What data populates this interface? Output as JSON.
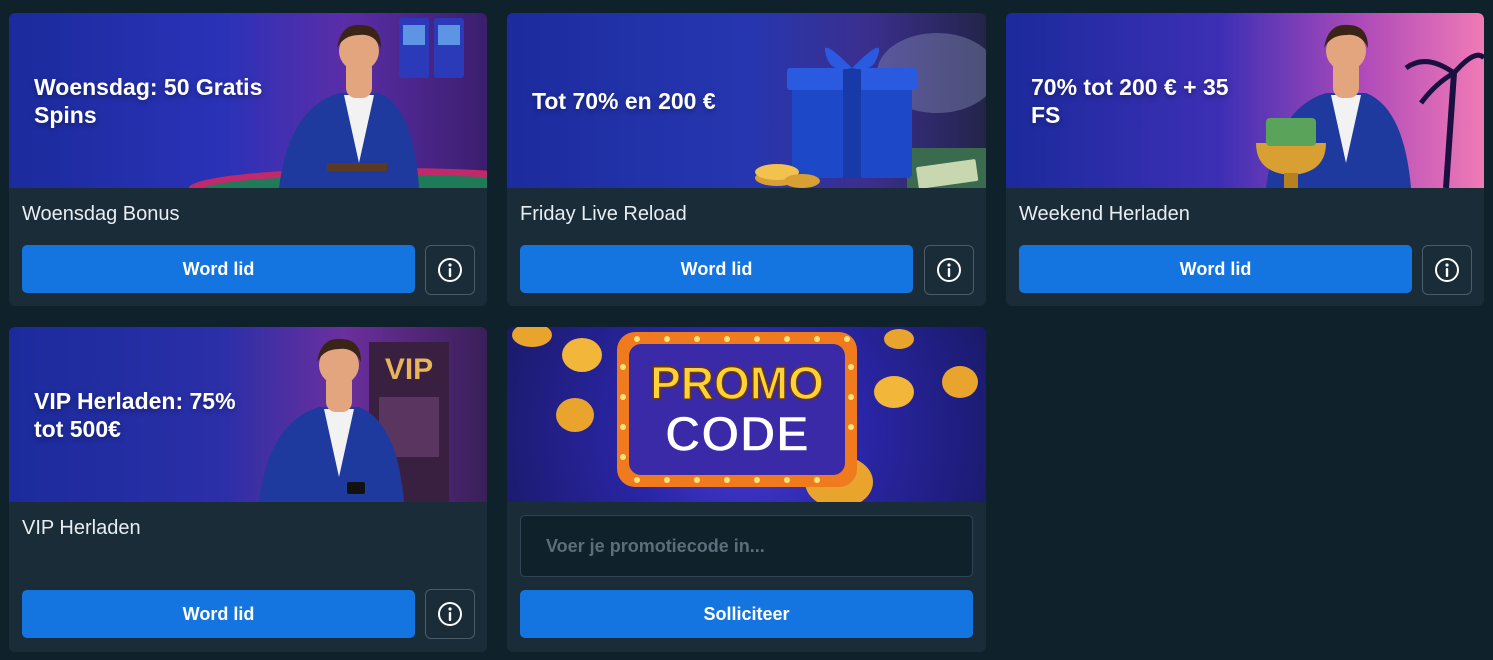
{
  "cards": [
    {
      "banner_text": "Woensdag: 50 Gratis Spins",
      "title": "Woensdag Bonus",
      "button_label": "Word lid"
    },
    {
      "banner_text": "Tot 70% en 200 €",
      "title": "Friday Live Reload",
      "button_label": "Word lid"
    },
    {
      "banner_text": "70% tot 200 € + 35 FS",
      "title": "Weekend Herladen",
      "button_label": "Word lid"
    },
    {
      "banner_text": "VIP Herladen: 75% tot 500€",
      "title": "VIP Herladen",
      "button_label": "Word lid",
      "banner_sign": "VIP"
    }
  ],
  "promo": {
    "banner_line1": "PROMO",
    "banner_line2": "CODE",
    "input_placeholder": "Voer je promotiecode in...",
    "input_value": "",
    "button_label": "Solliciteer"
  },
  "colors": {
    "page_bg": "#0f212b",
    "card_bg": "#1a2c38",
    "primary_button": "#1475e1",
    "text": "#e8edf2"
  },
  "icons": {
    "info": "info-circle-icon"
  }
}
